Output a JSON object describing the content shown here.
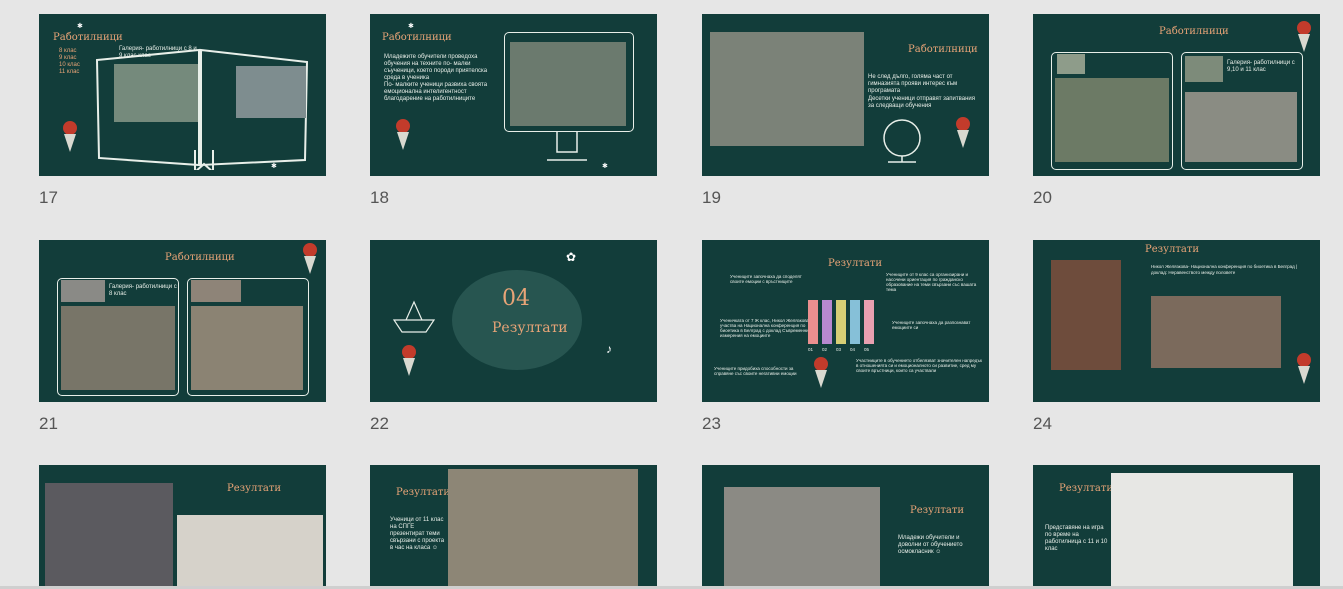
{
  "slides": [
    {
      "number": "17",
      "title": "Работилници",
      "bullets": [
        "8 клас",
        "9 клас",
        "10 клас",
        "11 клас"
      ],
      "caption": "Галерия- работилници с 8 и 9 клас клас"
    },
    {
      "number": "18",
      "title": "Работилници",
      "bullets": [
        "Младежите обучители проведоха обучения на техните по- малки съученици, което породи приятелска среда в ученика",
        "По- малките ученици развиха своята емоционална интелигентност благодарение на работилниците"
      ]
    },
    {
      "number": "19",
      "title": "Работилници",
      "bullets": [
        "Не след дълго, голяма част от гимназията прояви интерес към програмата",
        "Десетки ученици отправят запитвания за следващи обучения"
      ]
    },
    {
      "number": "20",
      "title": "Работилници",
      "caption": "Галерия- работилници с 9,10 и 11 клас"
    },
    {
      "number": "21",
      "title": "Работилници",
      "caption": "Галерия- работилници с 8 клас"
    },
    {
      "number": "22",
      "section_number": "04",
      "title": "Резултати"
    },
    {
      "number": "23",
      "title": "Резултати",
      "notes": [
        "Учениците започнаха да споделят своите емоции с връстниците",
        "Учениците от 9 клас са организирани и насочени ориентация по гражданско образование на теми свързани със вашата тема",
        "Ученичката от 7 Ж клас, Никол Желязкова, участва на Национална конференция по биоетика в Белград с доклад Съвременни измерения на емоциите",
        "Учениците започнаха да разпознават емоциите си",
        "Учениците придобиха способности за справяне със своите негативни емоции",
        "Участниците в обучението отбелязват значителен напредък в отношенията си и емоционалното си развитие, сред му своите връстници, които са участвали"
      ],
      "chart_labels": [
        "01",
        "02",
        "03",
        "04",
        "05"
      ]
    },
    {
      "number": "24",
      "title": "Резултати",
      "caption": "Никол Желязкова- Национална конференция по биоетика в Белград | доклад: Неравенството между половете"
    },
    {
      "number": "",
      "title": "Резултати"
    },
    {
      "number": "",
      "title": "Резултати",
      "caption": "Ученици от 11 клас на СПГЕ презентират теми свързани с проекта в час на класа ☺"
    },
    {
      "number": "",
      "title": "Резултати",
      "caption": "Младежи обучители и доволни от обучението осмокласник ☺"
    },
    {
      "number": "",
      "title": "Резултати",
      "caption": "Представяне на игра по време на работилница с 11 и 10 клас"
    }
  ],
  "colors": {
    "slide_bg": "#123d3a",
    "title": "#e8a477",
    "text": "#e9efe9",
    "app_bg": "#e6e6e6"
  }
}
